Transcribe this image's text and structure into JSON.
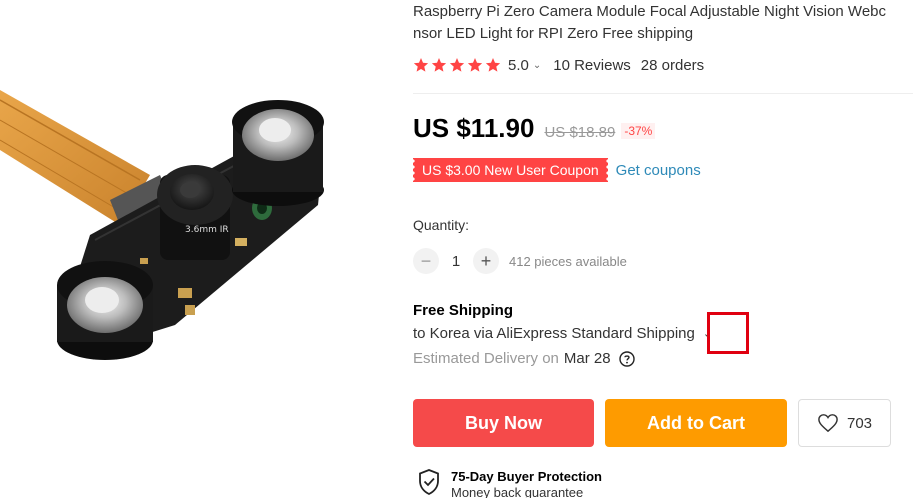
{
  "product": {
    "title_line1": "Raspberry Pi Zero Camera Module Focal Adjustable Night Vision Webc",
    "title_line2": "nsor LED Light for RPI Zero Free shipping",
    "image_alt": "camera-module-photo",
    "lens_label": "3.6mm IR"
  },
  "rating": {
    "stars": 5,
    "value": "5.0",
    "reviews": "10 Reviews",
    "orders": "28 orders",
    "star_color": "#f44"
  },
  "price": {
    "current": "US $11.90",
    "original": "US $18.89",
    "discount": "-37%"
  },
  "coupon": {
    "badge": "US $3.00 New User Coupon",
    "link": "Get coupons"
  },
  "quantity": {
    "label": "Quantity:",
    "value": "1",
    "available": "412 pieces available",
    "minus": "−",
    "plus": "+"
  },
  "shipping": {
    "title": "Free Shipping",
    "destination": "to Korea via AliExpress Standard Shipping",
    "chevron": "⌄",
    "delivery_label": "Estimated Delivery on",
    "delivery_date": "Mar 28"
  },
  "actions": {
    "buy_now": "Buy Now",
    "add_to_cart": "Add to Cart",
    "wishlist_count": "703"
  },
  "protection": {
    "title": "75-Day Buyer Protection",
    "subtitle": "Money back guarantee"
  },
  "colors": {
    "buy_now": "#f54a4a",
    "add_to_cart": "#fe9b00",
    "coupon": "#f44",
    "link": "#2e8ab8",
    "highlight": "#e00010"
  }
}
